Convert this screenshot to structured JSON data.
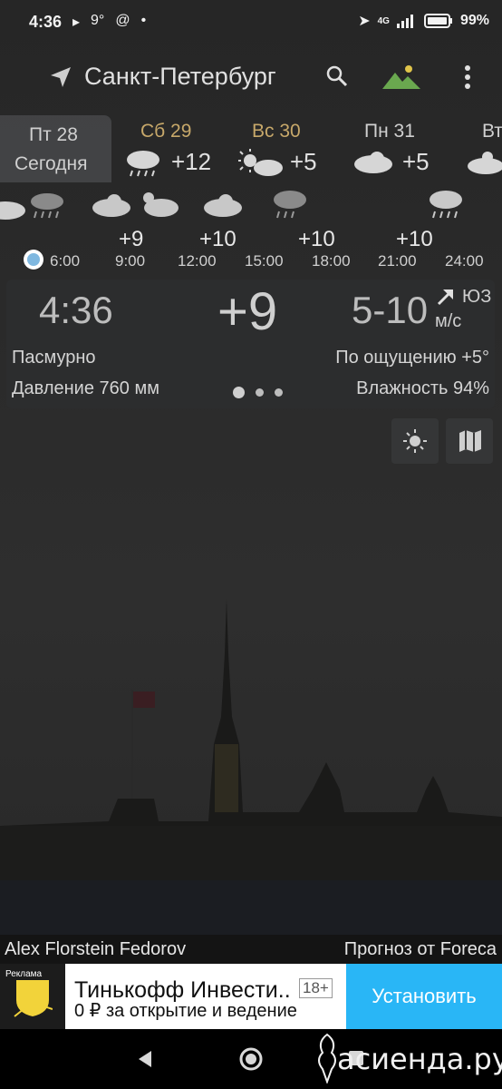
{
  "status": {
    "time": "4:36",
    "temp": "9°",
    "battery": "99%",
    "network": "4G"
  },
  "header": {
    "city": "Санкт-Петербург"
  },
  "days": [
    {
      "label": "Пт 28",
      "sub": "Сегодня",
      "temp": "",
      "weekend": false
    },
    {
      "label": "Сб 29",
      "sub": "",
      "temp": "+12",
      "weekend": true
    },
    {
      "label": "Вс 30",
      "sub": "",
      "temp": "+5",
      "weekend": true
    },
    {
      "label": "Пн 31",
      "sub": "",
      "temp": "+5",
      "weekend": false
    },
    {
      "label": "Вт",
      "sub": "",
      "temp": "",
      "weekend": false
    }
  ],
  "hours": [
    {
      "time": "6:00",
      "temp": ""
    },
    {
      "time": "9:00",
      "temp": "+9"
    },
    {
      "time": "12:00",
      "temp": "+10"
    },
    {
      "time": "15:00",
      "temp": ""
    },
    {
      "time": "18:00",
      "temp": "+10"
    },
    {
      "time": "21:00",
      "temp": "+10"
    },
    {
      "time": "24:00",
      "temp": ""
    }
  ],
  "current": {
    "time": "4:36",
    "temp": "+9",
    "wind": "5-10",
    "wind_dir": "ЮЗ",
    "wind_unit": "м/с",
    "condition": "Пасмурно",
    "feels_like": "По ощущению +5°",
    "pressure": "Давление 760 мм",
    "humidity": "Влажность 94%"
  },
  "credits": {
    "photo": "Alex Florstein Fedorov",
    "source": "Прогноз от Foreca"
  },
  "ad": {
    "badge": "Реклама",
    "title": "Тинькофф Инвести..",
    "age": "18+",
    "subtitle": "0 ₽ за открытие и ведение",
    "button": "Установить"
  },
  "watermark": "асиенда.ру",
  "colors": {
    "accent_gold": "#c7a86a",
    "ad_button": "#29b6f6",
    "indicator_dot": "#7fb8e0"
  }
}
